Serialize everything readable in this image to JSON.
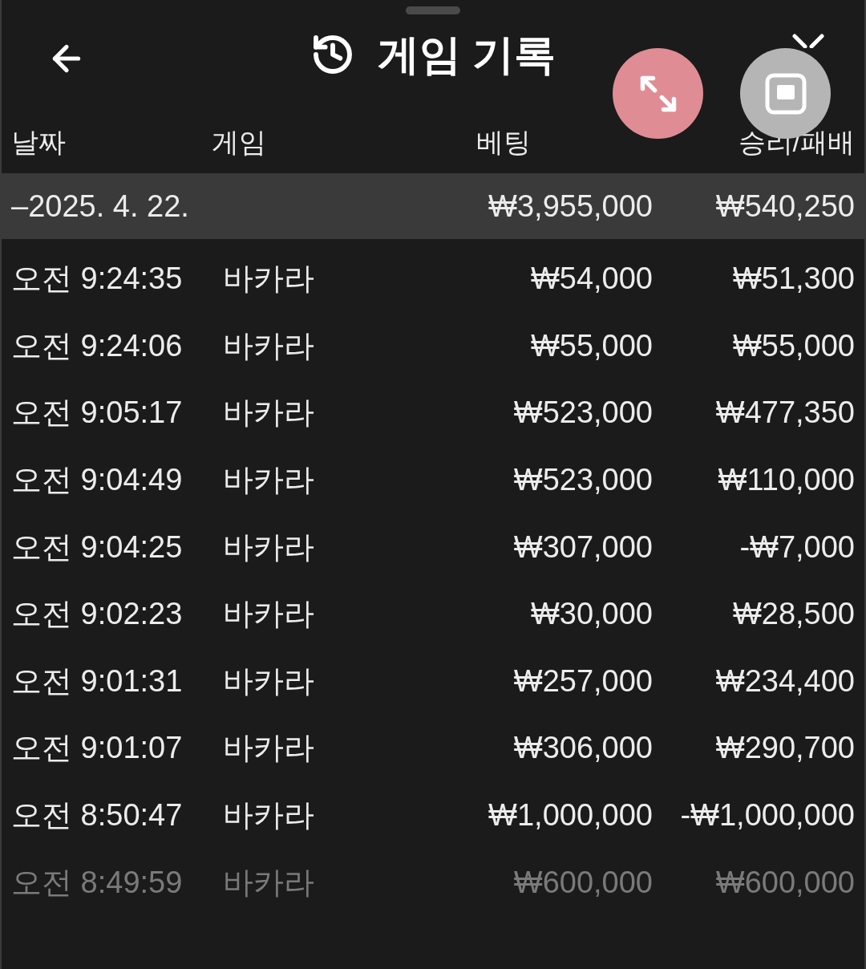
{
  "header": {
    "title": "게임 기록"
  },
  "table": {
    "columns": [
      "날짜",
      "게임",
      "베팅",
      "승리/패배"
    ],
    "group": {
      "expanded": true,
      "toggle": "–",
      "date": "2025. 4. 22.",
      "bet": "₩3,955,000",
      "result": "₩540,250"
    },
    "rows": [
      {
        "time": "오전 9:24:35",
        "game": "바카라",
        "bet": "₩54,000",
        "result": "₩51,300",
        "faded": false
      },
      {
        "time": "오전 9:24:06",
        "game": "바카라",
        "bet": "₩55,000",
        "result": "₩55,000",
        "faded": false
      },
      {
        "time": "오전 9:05:17",
        "game": "바카라",
        "bet": "₩523,000",
        "result": "₩477,350",
        "faded": false
      },
      {
        "time": "오전 9:04:49",
        "game": "바카라",
        "bet": "₩523,000",
        "result": "₩110,000",
        "faded": false
      },
      {
        "time": "오전 9:04:25",
        "game": "바카라",
        "bet": "₩307,000",
        "result": "-₩7,000",
        "faded": false
      },
      {
        "time": "오전 9:02:23",
        "game": "바카라",
        "bet": "₩30,000",
        "result": "₩28,500",
        "faded": false
      },
      {
        "time": "오전 9:01:31",
        "game": "바카라",
        "bet": "₩257,000",
        "result": "₩234,400",
        "faded": false
      },
      {
        "time": "오전 9:01:07",
        "game": "바카라",
        "bet": "₩306,000",
        "result": "₩290,700",
        "faded": false
      },
      {
        "time": "오전 8:50:47",
        "game": "바카라",
        "bet": "₩1,000,000",
        "result": "-₩1,000,000",
        "faded": false
      },
      {
        "time": "오전 8:49:59",
        "game": "바카라",
        "bet": "₩600,000",
        "result": "₩600,000",
        "faded": true
      }
    ]
  }
}
